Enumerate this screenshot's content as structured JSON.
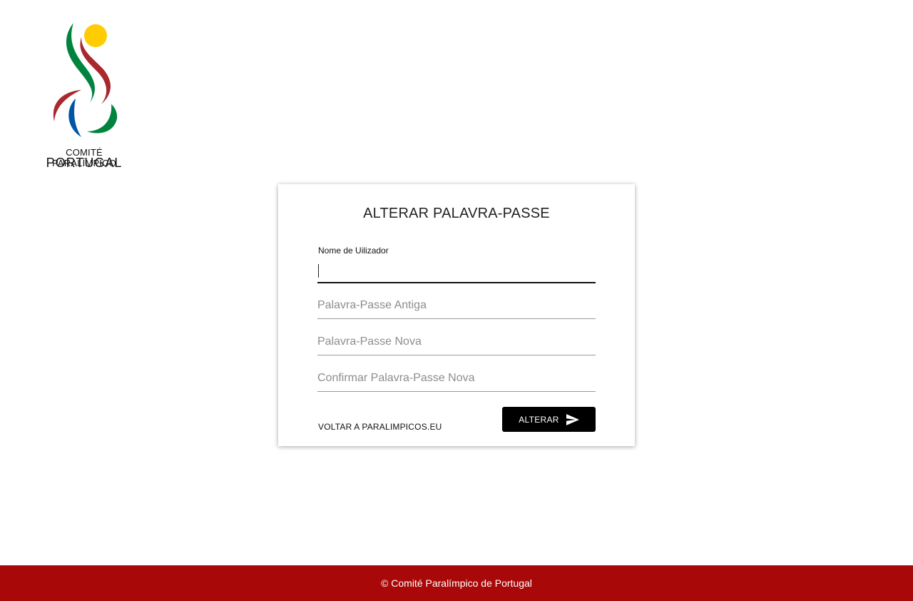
{
  "brand": {
    "logo_line_1": "COMITÉ PARALÍMPICO",
    "logo_line_2": "PORTUGAL",
    "colors": {
      "yellow": "#FFCC00",
      "green": "#00843D",
      "red": "#A8282D",
      "blue": "#0055A5"
    }
  },
  "form": {
    "title": "ALTERAR PALAVRA-PASSE",
    "username": {
      "label": "Nome de Uilizador",
      "value": ""
    },
    "old_password": {
      "placeholder": "Palavra-Passe Antiga",
      "value": ""
    },
    "new_password": {
      "placeholder": "Palavra-Passe Nova",
      "value": ""
    },
    "confirm_password": {
      "placeholder": "Confirmar Palavra-Passe Nova",
      "value": ""
    },
    "back_link": "VOLTAR A PARALIMPICOS.EU",
    "submit_label": "ALTERAR",
    "submit_icon": "send-icon"
  },
  "footer": {
    "text": "© Comité Paralímpico de Portugal",
    "background": "#A80808"
  }
}
